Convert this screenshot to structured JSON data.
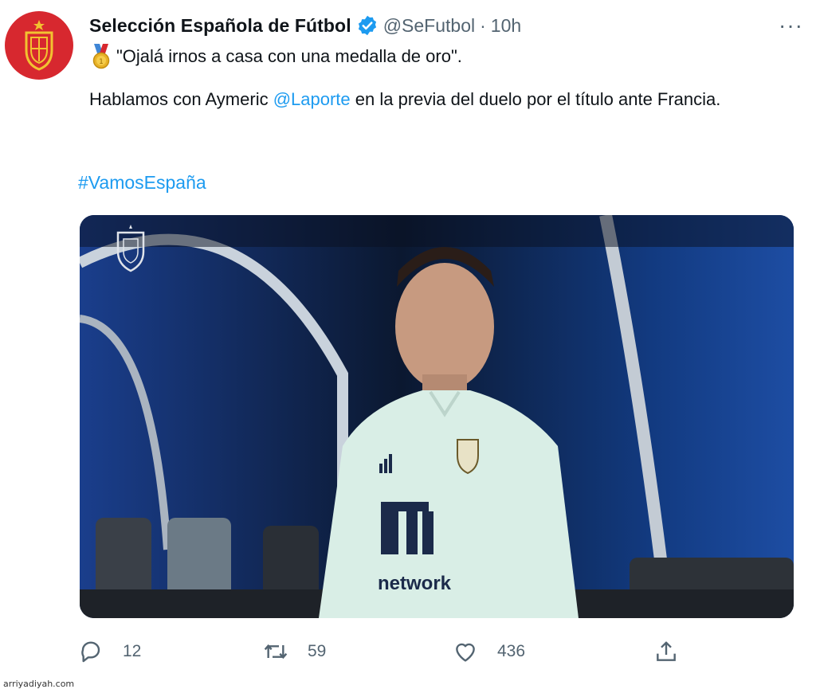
{
  "tweet": {
    "author_name": "Selección Española de Fútbol",
    "handle": "@SeFutbol",
    "separator": "·",
    "time": "10h",
    "more_label": "···",
    "line1": "\"Ojalá irnos a casa con una medalla de oro\".",
    "line2_before": "Hablamos con Aymeric ",
    "mention": "@Laporte",
    "line2_after": " en la previa del duelo por el título ante Francia.",
    "hashtag": "#VamosEspaña",
    "media_text": "network"
  },
  "actions": {
    "reply_count": "12",
    "retweet_count": "59",
    "like_count": "436"
  },
  "icons": [
    "verified-badge-icon",
    "medal-icon",
    "reply-icon",
    "retweet-icon",
    "like-icon",
    "share-icon",
    "more-icon"
  ],
  "colors": {
    "link": "#1d9bf0",
    "muted": "#536471",
    "avatar_bg": "#d7282f"
  },
  "watermark": "arriyadiyah.com"
}
